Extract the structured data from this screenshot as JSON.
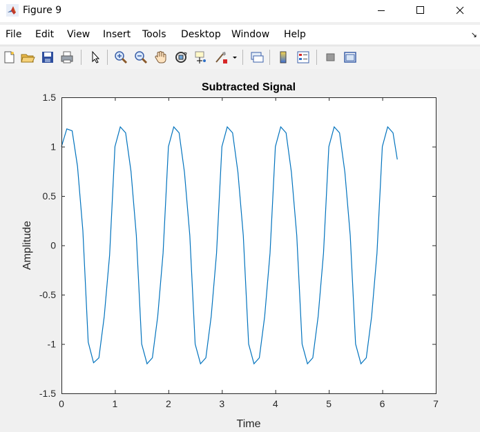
{
  "window": {
    "title": "Figure 9",
    "minimize_icon": "minimize-icon",
    "maximize_icon": "maximize-icon",
    "close_icon": "close-icon"
  },
  "menu": {
    "items": [
      "File",
      "Edit",
      "View",
      "Insert",
      "Tools",
      "Desktop",
      "Window",
      "Help"
    ]
  },
  "toolbar": {
    "icons": [
      "new-figure-icon",
      "open-file-icon",
      "save-icon",
      "print-icon",
      "pointer-icon",
      "zoom-in-icon",
      "zoom-out-icon",
      "pan-icon",
      "rotate-3d-icon",
      "data-cursor-icon",
      "brush-icon",
      "brush-dropdown-icon",
      "link-plot-icon",
      "colorbar-icon",
      "legend-icon",
      "hide-plot-tools-icon",
      "show-plot-tools-icon"
    ]
  },
  "colors": {
    "line": "#0072BD",
    "axes_bg": "#ffffff",
    "figure_bg": "#f0f0f0"
  },
  "chart_data": {
    "type": "line",
    "title": "Subtracted Signal",
    "xlabel": "Time",
    "ylabel": "Amplitude",
    "xlim": [
      0,
      7
    ],
    "ylim": [
      -1.5,
      1.5
    ],
    "xticks": [
      "0",
      "1",
      "2",
      "3",
      "4",
      "5",
      "6",
      "7"
    ],
    "yticks": [
      "1.5",
      "1",
      "0.5",
      "0",
      "-0.5",
      "-1",
      "-1.5"
    ],
    "grid": false,
    "series": [
      {
        "x": [
          0,
          0.1,
          0.2,
          0.3,
          0.4,
          0.5,
          0.6,
          0.7,
          0.8,
          0.9,
          1.0,
          1.1,
          1.2,
          1.3,
          1.4,
          1.5,
          1.6,
          1.7,
          1.8,
          1.9,
          2.0,
          2.1,
          2.2,
          2.3,
          2.4,
          2.5,
          2.6,
          2.7,
          2.8,
          2.9,
          3.0,
          3.1,
          3.2,
          3.3,
          3.4,
          3.5,
          3.6,
          3.7,
          3.8,
          3.9,
          4.0,
          4.1,
          4.2,
          4.3,
          4.4,
          4.5,
          4.6,
          4.7,
          4.8,
          4.9,
          5.0,
          5.1,
          5.2,
          5.3,
          5.4,
          5.5,
          5.6,
          5.7,
          5.8,
          5.9,
          6.0,
          6.1,
          6.2,
          6.28
        ],
        "y": [
          1.0,
          1.18,
          1.16,
          0.8,
          0.15,
          -0.98,
          -1.19,
          -1.14,
          -0.72,
          -0.1,
          1.0,
          1.2,
          1.14,
          0.75,
          0.1,
          -1.0,
          -1.2,
          -1.14,
          -0.72,
          -0.08,
          1.0,
          1.2,
          1.14,
          0.74,
          0.1,
          -1.0,
          -1.2,
          -1.14,
          -0.72,
          -0.08,
          1.0,
          1.2,
          1.14,
          0.74,
          0.1,
          -1.0,
          -1.2,
          -1.14,
          -0.72,
          -0.08,
          1.0,
          1.2,
          1.14,
          0.74,
          0.1,
          -1.0,
          -1.2,
          -1.14,
          -0.72,
          -0.08,
          1.0,
          1.2,
          1.14,
          0.74,
          0.1,
          -1.0,
          -1.2,
          -1.14,
          -0.72,
          -0.08,
          1.0,
          1.2,
          1.14,
          0.87
        ]
      }
    ]
  }
}
